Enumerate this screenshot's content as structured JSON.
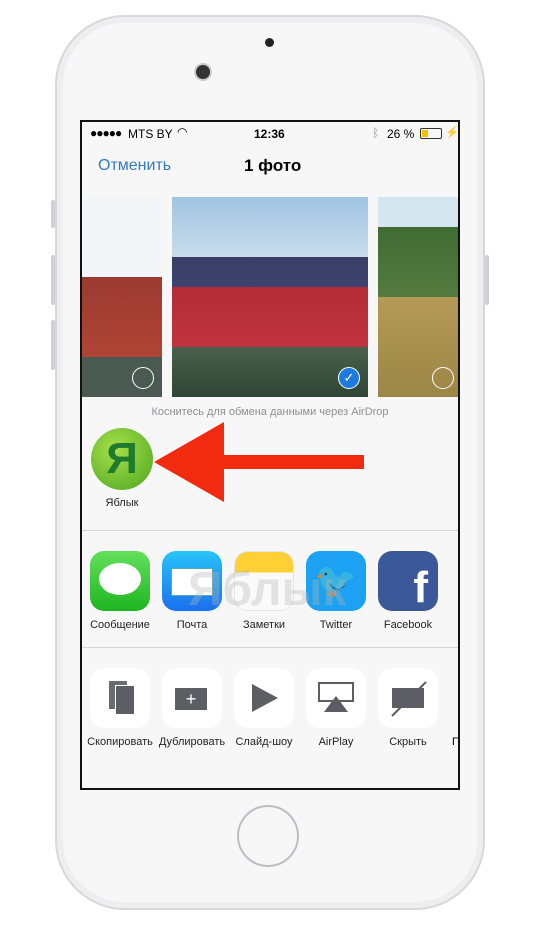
{
  "status": {
    "carrier": "MTS BY",
    "time": "12:36",
    "battery": "26 %"
  },
  "nav": {
    "cancel": "Отменить",
    "title": "1 фото"
  },
  "airdrop": {
    "caption": "Коснитесь для обмена данными через AirDrop",
    "contact": "Яблык"
  },
  "apps": [
    {
      "label": "Сообщение"
    },
    {
      "label": "Почта"
    },
    {
      "label": "Заметки"
    },
    {
      "label": "Twitter"
    },
    {
      "label": "Facebook"
    }
  ],
  "actions": [
    {
      "label": "Скопировать"
    },
    {
      "label": "Дублировать"
    },
    {
      "label": "Слайд-шоу"
    },
    {
      "label": "AirPlay"
    },
    {
      "label": "Скрыть"
    },
    {
      "label": "П"
    }
  ],
  "watermark": "Яблык",
  "colors": {
    "accent": "#3478c6",
    "arrow": "#f22a10",
    "check": "#1f7ae0"
  }
}
